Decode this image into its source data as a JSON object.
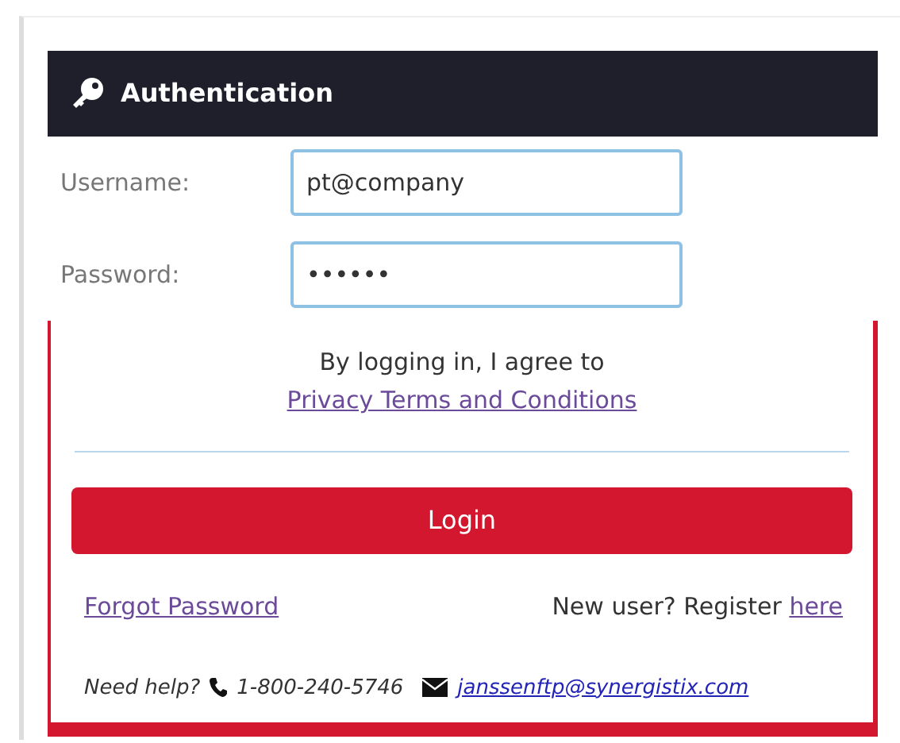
{
  "header": {
    "title": "Authentication"
  },
  "fields": [
    {
      "label": "Username:",
      "value": "pt@company"
    },
    {
      "label": "Password:",
      "value": "••••••"
    }
  ],
  "agreement": {
    "text": "By logging in, I agree to",
    "link": "Privacy Terms and Conditions"
  },
  "login_button": "Login",
  "links": {
    "forgot": "Forgot Password",
    "register_text": "New user? Register",
    "register_link": "here"
  },
  "help": {
    "label": "Need help?",
    "phone": "1-800-240-5746",
    "email": "janssenftp@synergistix.com"
  }
}
